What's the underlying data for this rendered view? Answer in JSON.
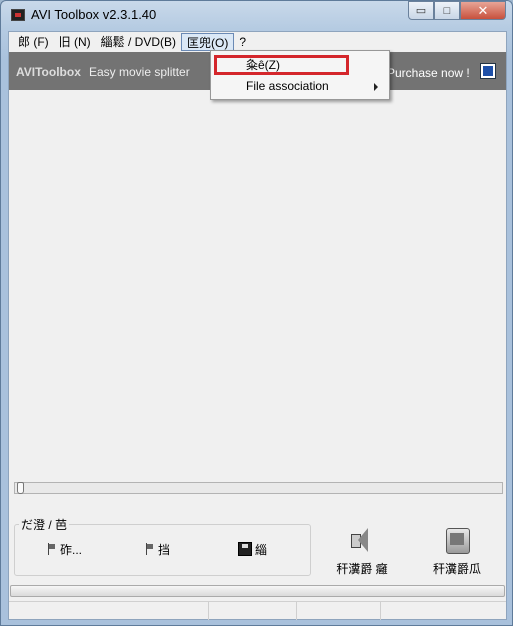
{
  "window": {
    "title": "AVI Toolbox v2.3.1.40",
    "minimize_glyph": "▭",
    "maximize_glyph": "□",
    "close_glyph": "✕"
  },
  "menubar": {
    "items": [
      {
        "label": "郎  (F)"
      },
      {
        "label": "旧  (N)"
      },
      {
        "label": "緇鬆 / DVD(B)"
      },
      {
        "label": "匡兜(O)"
      },
      {
        "label": "?"
      }
    ],
    "active_index": 3
  },
  "banner": {
    "brand": "AVIToolbox",
    "tagline": "Easy movie splitter",
    "purchase": "Purchase now !"
  },
  "dropdown": {
    "items": [
      {
        "label": "粂ê(Z)"
      },
      {
        "label": "File association"
      }
    ]
  },
  "controls": {
    "group_label": "だ澄 /  芭",
    "button1": "砟...",
    "button2": "挡",
    "button3": "緇",
    "big1": "秆瀵爵  癰",
    "big2": "秆瀵爵瓜"
  },
  "icons": {
    "app": "app-icon",
    "flag": "flag-icon",
    "disk": "disk-icon",
    "speaker": "speaker-icon",
    "capture": "capture-icon",
    "logo": "logo-icon",
    "submenu": "chevron-right-icon"
  },
  "colors": {
    "banner_bg": "#737373",
    "highlight_box": "#d4262b",
    "client_bg": "#f0f0f0"
  }
}
